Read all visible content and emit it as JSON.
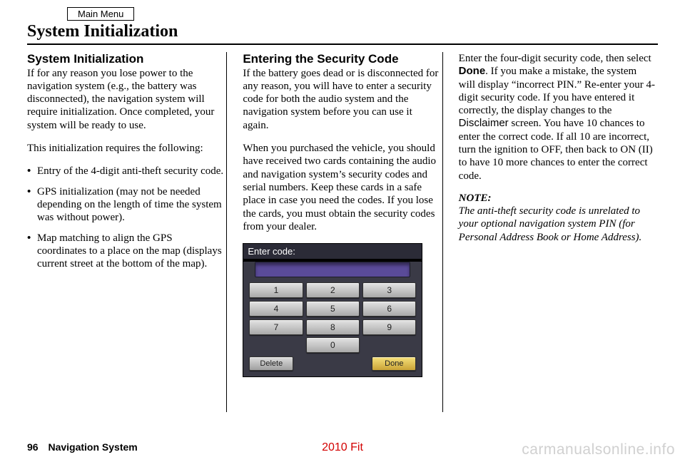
{
  "header": {
    "main_menu": "Main Menu",
    "title": "System Initialization"
  },
  "col1": {
    "heading": "System Initialization",
    "p1": "If for any reason you lose power to the navigation system (e.g., the battery was disconnected), the navigation system will require initialization. Once completed, your system will be ready to use.",
    "p2": "This initialization requires the following:",
    "bullets": [
      "Entry of the 4-digit anti-theft security code.",
      "GPS initialization (may not be needed depending on the length of time the system was without power).",
      "Map matching to align the GPS coordinates to a place on the map (displays current street at the bottom of the map)."
    ]
  },
  "col2": {
    "heading": "Entering the Security Code",
    "p1": "If the battery goes dead or is disconnected for any reason, you will have to enter a security code for both the audio system and the navigation system before you can use it again.",
    "p2": "When you purchased the vehicle, you should have received two cards containing the audio and navigation system’s security codes and serial numbers. Keep these cards in a safe place in case you need the codes. If you lose the cards, you must obtain the security codes from your dealer.",
    "keypad": {
      "prompt": "Enter code:",
      "keys": [
        "1",
        "2",
        "3",
        "4",
        "5",
        "6",
        "7",
        "8",
        "9",
        "0"
      ],
      "delete": "Delete",
      "done": "Done"
    }
  },
  "col3": {
    "p1a": "Enter the four-digit security code, then select ",
    "done_word": "Done",
    "p1b": ". If you make a mistake, the system will display “incorrect PIN.” Re-enter your 4-digit security code. If you have entered it correctly, the display changes to the ",
    "disclaimer_word": "Disclaimer",
    "p1c": " screen. You have 10 chances to enter the correct code. If all 10 are incorrect, turn the ignition to OFF, then back to ON (II) to have 10 more chances to enter the correct code.",
    "note_label": "NOTE:",
    "note_text": "The anti-theft security code is unrelated to your optional navigation system PIN (for Personal Address Book or Home Address)."
  },
  "footer": {
    "page_number": "96",
    "section": "Navigation System",
    "model": "2010 Fit",
    "watermark": "carmanualsonline.info"
  }
}
